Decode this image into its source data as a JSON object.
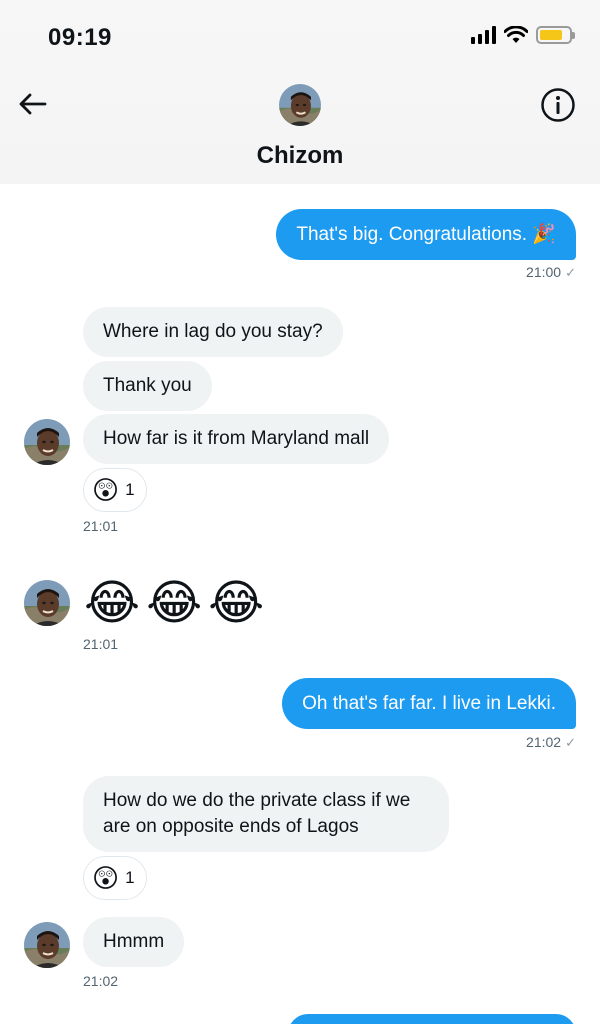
{
  "status_bar": {
    "time": "09:19"
  },
  "header": {
    "contact_name": "Chizom"
  },
  "messages": [
    {
      "text": "That's big. Congratulations. 🎉",
      "time": "21:00"
    },
    {
      "text": "Where in lag do you stay?"
    },
    {
      "text": "Thank you"
    },
    {
      "text": "How far is it from Maryland mall",
      "reaction": {
        "emoji": "😲",
        "count": "1"
      },
      "time": "21:01"
    },
    {
      "text": "😂😂😂",
      "time": "21:01"
    },
    {
      "text": "Oh that's far far. I live in Lekki.",
      "time": "21:02"
    },
    {
      "text": "How do we do the private class if we are on opposite ends of Lagos",
      "reaction": {
        "emoji": "😲",
        "count": "1"
      }
    },
    {
      "text": "Hmmm",
      "time": "21:02"
    }
  ],
  "icons": {
    "back": "back-arrow-icon",
    "info": "info-icon",
    "signal": "signal-icon",
    "wifi": "wifi-icon",
    "battery": "battery-icon",
    "read_receipt": "check-icon"
  },
  "colors": {
    "accent": "#1d9bf0",
    "incoming_bubble": "#eff3f4",
    "battery": "#f5c518"
  }
}
